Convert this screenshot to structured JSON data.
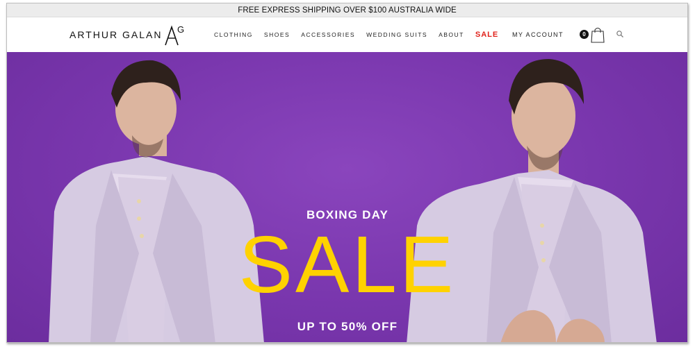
{
  "promo_bar": {
    "text": "FREE EXPRESS SHIPPING OVER $100 AUSTRALIA WIDE"
  },
  "header": {
    "logo": {
      "text": "ARTHUR GALAN",
      "mark": "AG"
    },
    "nav": [
      {
        "label": "CLOTHING"
      },
      {
        "label": "SHOES"
      },
      {
        "label": "ACCESSORIES"
      },
      {
        "label": "WEDDING SUITS"
      },
      {
        "label": "ABOUT"
      },
      {
        "label": "SALE"
      }
    ],
    "account_label": "MY ACCOUNT",
    "cart_count": "0",
    "icons": {
      "cart": "shopping-bag-icon",
      "search": "search-icon"
    }
  },
  "hero": {
    "event": "BOXING DAY",
    "headline": "SALE",
    "discount": "UP TO 50% OFF"
  },
  "colors": {
    "hero_background": "#7936ad",
    "headline": "#ffd200",
    "sale_nav": "#e0221b",
    "suit": "#d8cde3"
  }
}
